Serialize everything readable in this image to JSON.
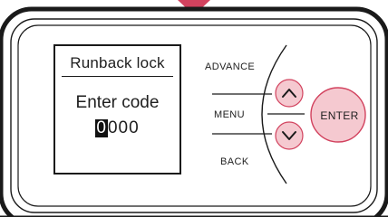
{
  "colors": {
    "bezel": "#1a1a1a",
    "button_fill": "#f5c9d0",
    "button_border": "#d2425e",
    "indicator_arrow": "#d2425e"
  },
  "display": {
    "title": "Runback lock",
    "prompt": "Enter code",
    "code_cursor_digit": "0",
    "code_rest": "000"
  },
  "buttons": {
    "advance_label": "ADVANCE",
    "menu_label": "MENU",
    "back_label": "BACK",
    "enter_label": "ENTER",
    "up_icon": "chevron-up",
    "down_icon": "chevron-down"
  }
}
